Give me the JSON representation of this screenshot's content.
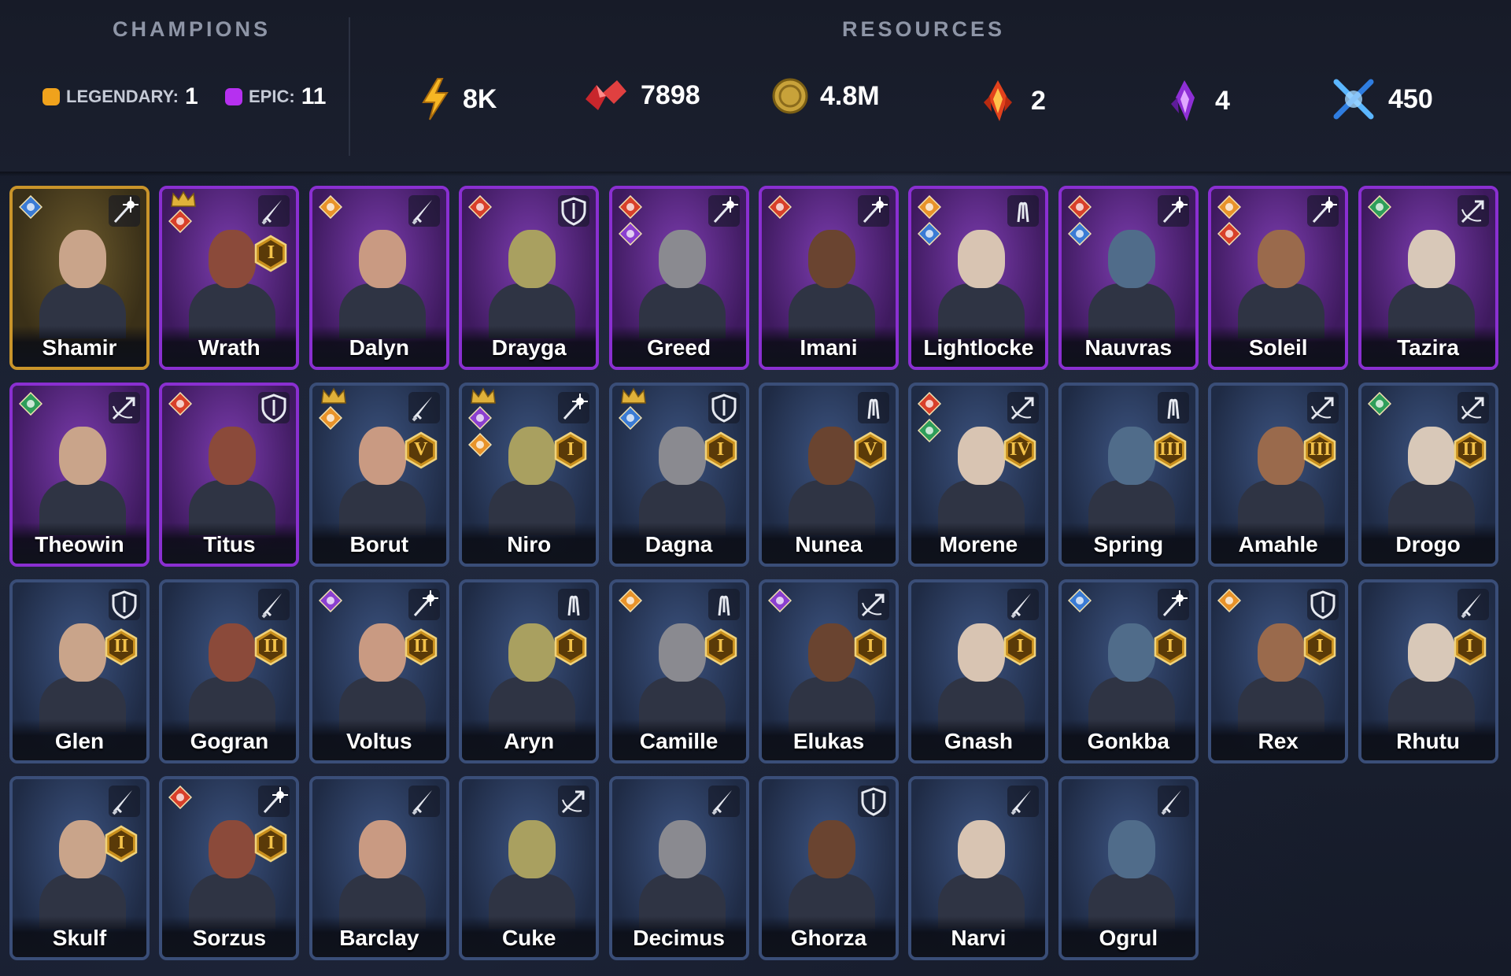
{
  "header": {
    "champions_title": "CHAMPIONS",
    "resources_title": "RESOURCES",
    "rarity": [
      {
        "label": "LEGENDARY:",
        "count": "1",
        "color": "#f0a21c"
      },
      {
        "label": "EPIC:",
        "count": "11",
        "color": "#b630f0"
      }
    ],
    "resources": [
      {
        "icon": "energy-icon",
        "value": "8K"
      },
      {
        "icon": "gems-icon",
        "value": "7898"
      },
      {
        "icon": "silver-coin-icon",
        "value": "4.8M"
      },
      {
        "icon": "fire-shard-icon",
        "value": "2"
      },
      {
        "icon": "void-shard-icon",
        "value": "4"
      },
      {
        "icon": "arena-token-icon",
        "value": "450"
      }
    ]
  },
  "colors": {
    "legendary": "#c9942a",
    "epic": "#8a2fd1",
    "rare": "#3a4e78"
  },
  "champions": [
    {
      "name": "Shamir",
      "rarity": "legendary",
      "role": "staff-icon",
      "affinities": [
        "magic"
      ],
      "rank": "",
      "crown": false
    },
    {
      "name": "Wrath",
      "rarity": "epic",
      "role": "sword-icon",
      "affinities": [
        "fire"
      ],
      "rank": "I",
      "crown": true
    },
    {
      "name": "Dalyn",
      "rarity": "epic",
      "role": "sword-icon",
      "affinities": [
        "force"
      ],
      "rank": "",
      "crown": false
    },
    {
      "name": "Drayga",
      "rarity": "epic",
      "role": "shield-icon",
      "affinities": [
        "fire"
      ],
      "rank": "",
      "crown": false
    },
    {
      "name": "Greed",
      "rarity": "epic",
      "role": "staff-icon",
      "affinities": [
        "fire",
        "void"
      ],
      "rank": "",
      "crown": false
    },
    {
      "name": "Imani",
      "rarity": "epic",
      "role": "staff-icon",
      "affinities": [
        "fire"
      ],
      "rank": "",
      "crown": false
    },
    {
      "name": "Lightlocke",
      "rarity": "epic",
      "role": "support-icon",
      "affinities": [
        "force",
        "magic"
      ],
      "rank": "",
      "crown": false
    },
    {
      "name": "Nauvras",
      "rarity": "epic",
      "role": "staff-icon",
      "affinities": [
        "fire",
        "magic"
      ],
      "rank": "",
      "crown": false
    },
    {
      "name": "Soleil",
      "rarity": "epic",
      "role": "staff-icon",
      "affinities": [
        "force",
        "fire"
      ],
      "rank": "",
      "crown": false
    },
    {
      "name": "Tazira",
      "rarity": "epic",
      "role": "bow-icon",
      "affinities": [
        "spirit"
      ],
      "rank": "",
      "crown": false
    },
    {
      "name": "Theowin",
      "rarity": "epic",
      "role": "bow-icon",
      "affinities": [
        "spirit"
      ],
      "rank": "",
      "crown": false
    },
    {
      "name": "Titus",
      "rarity": "epic",
      "role": "shield-icon",
      "affinities": [
        "fire"
      ],
      "rank": "",
      "crown": false
    },
    {
      "name": "Borut",
      "rarity": "rare",
      "role": "sword-icon",
      "affinities": [
        "force"
      ],
      "rank": "V",
      "crown": true
    },
    {
      "name": "Niro",
      "rarity": "rare",
      "role": "staff-icon",
      "affinities": [
        "void",
        "force"
      ],
      "rank": "I",
      "crown": true
    },
    {
      "name": "Dagna",
      "rarity": "rare",
      "role": "shield-icon",
      "affinities": [
        "magic"
      ],
      "rank": "I",
      "crown": true
    },
    {
      "name": "Nunea",
      "rarity": "rare",
      "role": "support-icon",
      "affinities": [],
      "rank": "V",
      "crown": false
    },
    {
      "name": "Morene",
      "rarity": "rare",
      "role": "bow-icon",
      "affinities": [
        "fire",
        "spirit"
      ],
      "rank": "IV",
      "crown": false
    },
    {
      "name": "Spring",
      "rarity": "rare",
      "role": "support-icon",
      "affinities": [],
      "rank": "III",
      "crown": false
    },
    {
      "name": "Amahle",
      "rarity": "rare",
      "role": "bow-icon",
      "affinities": [],
      "rank": "III",
      "crown": false
    },
    {
      "name": "Drogo",
      "rarity": "rare",
      "role": "bow-icon",
      "affinities": [
        "spirit"
      ],
      "rank": "II",
      "crown": false
    },
    {
      "name": "Glen",
      "rarity": "rare",
      "role": "shield-icon",
      "affinities": [],
      "rank": "II",
      "crown": false
    },
    {
      "name": "Gogran",
      "rarity": "rare",
      "role": "sword-icon",
      "affinities": [],
      "rank": "II",
      "crown": false
    },
    {
      "name": "Voltus",
      "rarity": "rare",
      "role": "staff-icon",
      "affinities": [
        "void"
      ],
      "rank": "II",
      "crown": false
    },
    {
      "name": "Aryn",
      "rarity": "rare",
      "role": "support-icon",
      "affinities": [],
      "rank": "I",
      "crown": false
    },
    {
      "name": "Camille",
      "rarity": "rare",
      "role": "support-icon",
      "affinities": [
        "force"
      ],
      "rank": "I",
      "crown": false
    },
    {
      "name": "Elukas",
      "rarity": "rare",
      "role": "bow-icon",
      "affinities": [
        "void"
      ],
      "rank": "I",
      "crown": false
    },
    {
      "name": "Gnash",
      "rarity": "rare",
      "role": "sword-icon",
      "affinities": [],
      "rank": "I",
      "crown": false
    },
    {
      "name": "Gonkba",
      "rarity": "rare",
      "role": "staff-icon",
      "affinities": [
        "magic"
      ],
      "rank": "I",
      "crown": false
    },
    {
      "name": "Rex",
      "rarity": "rare",
      "role": "shield-icon",
      "affinities": [
        "force"
      ],
      "rank": "I",
      "crown": false
    },
    {
      "name": "Rhutu",
      "rarity": "rare",
      "role": "sword-icon",
      "affinities": [],
      "rank": "I",
      "crown": false
    },
    {
      "name": "Skulf",
      "rarity": "rare",
      "role": "sword-icon",
      "affinities": [],
      "rank": "I",
      "crown": false
    },
    {
      "name": "Sorzus",
      "rarity": "rare",
      "role": "staff-icon",
      "affinities": [
        "fire"
      ],
      "rank": "I",
      "crown": false
    },
    {
      "name": "Barclay",
      "rarity": "rare",
      "role": "sword-icon",
      "affinities": [],
      "rank": "",
      "crown": false
    },
    {
      "name": "Cuke",
      "rarity": "rare",
      "role": "bow-icon",
      "affinities": [],
      "rank": "",
      "crown": false
    },
    {
      "name": "Decimus",
      "rarity": "rare",
      "role": "sword-icon",
      "affinities": [],
      "rank": "",
      "crown": false
    },
    {
      "name": "Ghorza",
      "rarity": "rare",
      "role": "shield-icon",
      "affinities": [],
      "rank": "",
      "crown": false
    },
    {
      "name": "Narvi",
      "rarity": "rare",
      "role": "sword-icon",
      "affinities": [],
      "rank": "",
      "crown": false
    },
    {
      "name": "Ogrul",
      "rarity": "rare",
      "role": "sword-icon",
      "affinities": [],
      "rank": "",
      "crown": false
    }
  ]
}
